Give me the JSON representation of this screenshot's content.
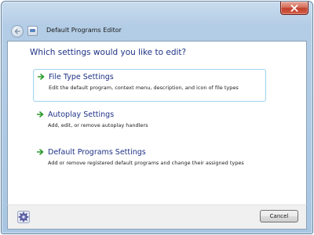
{
  "window": {
    "title": "Default Programs Editor"
  },
  "main": {
    "heading": "Which settings would you like to edit?",
    "options": [
      {
        "title": "File Type Settings",
        "description": "Edit the default program, context menu, description, and icon of file types",
        "icon": "green-arrow-icon",
        "selected": true
      },
      {
        "title": "Autoplay Settings",
        "description": "Add, edit, or remove autoplay handlers",
        "icon": "green-arrow-icon",
        "selected": false
      },
      {
        "title": "Default Programs Settings",
        "description": "Add or remove registered default programs and change their assigned types",
        "icon": "green-arrow-icon",
        "selected": false
      }
    ]
  },
  "footer": {
    "cancel_label": "Cancel",
    "icon": "settings-gear-icon"
  },
  "colors": {
    "accent_text": "#1e3287",
    "arrow_green": "#2a9a2a",
    "close_red": "#c0412e",
    "selection_border": "#a8d8f0"
  }
}
